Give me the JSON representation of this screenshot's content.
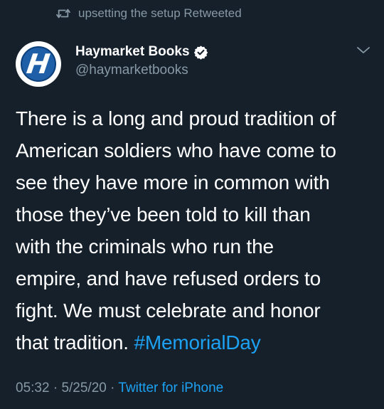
{
  "retweet": {
    "icon": "retweet-icon",
    "text": "upsetting the setup Retweeted"
  },
  "author": {
    "avatar_icon": "haymarket-logo-icon",
    "avatar_letter": "H",
    "display_name": "Haymarket Books",
    "verified_icon": "verified-badge-icon",
    "handle": "@haymarketbooks"
  },
  "menu": {
    "icon": "chevron-down-icon"
  },
  "tweet": {
    "lines": [
      "There is a long and proud tradition of",
      "American soldiers who have come to",
      "see they have more in common with",
      "those they’ve been told to kill than",
      "with the criminals who run the",
      "empire, and have refused orders to",
      "fight. We must celebrate and honor",
      "that tradition. "
    ],
    "hashtag": "#MemorialDay"
  },
  "meta": {
    "time": "05:32",
    "separator1": " · ",
    "date": "5/25/20",
    "separator2": " · ",
    "source": "Twitter for iPhone"
  },
  "colors": {
    "background": "#15202b",
    "secondary_text": "#8899a6",
    "accent": "#1da1f2",
    "primary_text": "#ffffff"
  }
}
